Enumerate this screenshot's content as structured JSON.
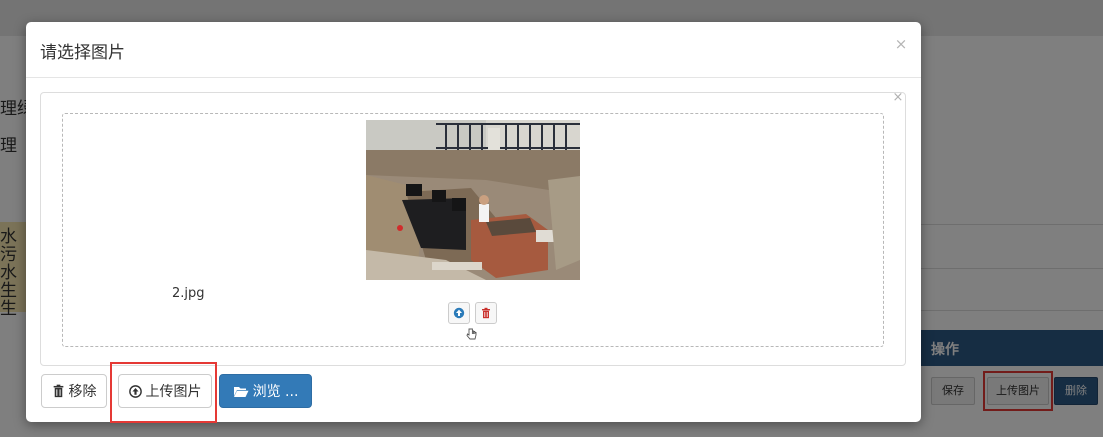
{
  "background": {
    "left_fragments": [
      "理绿",
      "理",
      "水",
      "污",
      "水",
      "生",
      "生"
    ],
    "operations_header": "操作",
    "save_label": "保存",
    "upload_label": "上传图片",
    "delete_label": "删除",
    "colors": {
      "header_bg": "#2c5a87",
      "highlight": "#e53935"
    }
  },
  "modal": {
    "title": "请选择图片",
    "close_glyph": "×",
    "panel_close_glyph": "×",
    "file": {
      "name": "2.jpg",
      "thumbnail": "construction-site-photo"
    },
    "footer": {
      "remove_label": "移除",
      "upload_label": "上传图片",
      "browse_label": "浏览 ..."
    },
    "icons": {
      "remove": "trash-icon",
      "upload": "circle-arrow-up-icon",
      "browse": "folder-open-icon",
      "thumb_upload": "circle-arrow-up-icon",
      "thumb_delete": "trash-icon",
      "drag": "hand-drag-icon"
    }
  }
}
